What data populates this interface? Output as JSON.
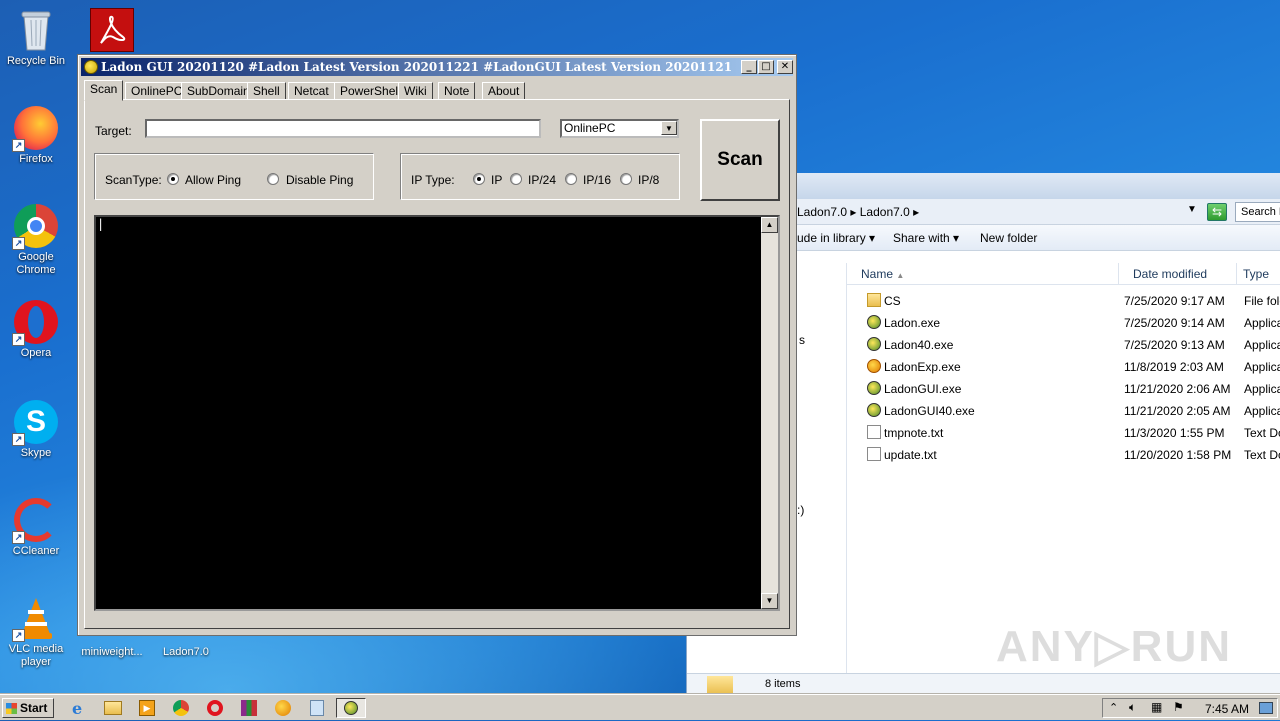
{
  "desktop": {
    "icons": [
      {
        "label": "Recycle Bin",
        "icon": "recycle-bin-icon"
      },
      {
        "label": "Firefox",
        "icon": "firefox-icon"
      },
      {
        "label": "Google Chrome",
        "icon": "chrome-icon"
      },
      {
        "label": "Opera",
        "icon": "opera-icon"
      },
      {
        "label": "Skype",
        "icon": "skype-icon"
      },
      {
        "label": "CCleaner",
        "icon": "ccleaner-icon"
      },
      {
        "label": "VLC media player",
        "icon": "vlc-icon"
      },
      {
        "label": "miniweight...",
        "icon": "file-icon"
      },
      {
        "label": "Ladon7.0",
        "icon": "folder-icon"
      }
    ]
  },
  "ladon": {
    "title": "Ladon GUI 20201120    #Ladon Latest Version 202011221    #LadonGUI Latest Version 20201121",
    "tabs": [
      "Scan",
      "OnlinePC",
      "SubDomain",
      "Shell",
      "Netcat",
      "PowerShell",
      "Wiki",
      "Note",
      "About"
    ],
    "target_label": "Target:",
    "target_value": "",
    "mode_selected": "OnlinePC",
    "scan_type_label": "ScanType:",
    "scan_type_options": [
      "Allow Ping",
      "Disable Ping"
    ],
    "scan_type_selected": "Allow Ping",
    "ip_type_label": "IP Type:",
    "ip_type_options": [
      "IP",
      "IP/24",
      "IP/16",
      "IP/8"
    ],
    "ip_type_selected": "IP",
    "scan_button": "Scan",
    "console_output": "|"
  },
  "explorer": {
    "breadcrumb": "Ladon7.0  ▸  Ladon7.0  ▸",
    "search_placeholder": "Search L",
    "toolbar": [
      "ude in library  ▾",
      "Share with  ▾",
      "New folder"
    ],
    "columns": [
      "Name",
      "Date modified",
      "Type"
    ],
    "files": [
      {
        "name": "CS",
        "date": "7/25/2020 9:17 AM",
        "type": "File fold",
        "icon": "folder-icon"
      },
      {
        "name": "Ladon.exe",
        "date": "7/25/2020 9:14 AM",
        "type": "Applicat",
        "icon": "ladon-exe-icon"
      },
      {
        "name": "Ladon40.exe",
        "date": "7/25/2020 9:13 AM",
        "type": "Applicat",
        "icon": "ladon-exe-icon"
      },
      {
        "name": "LadonExp.exe",
        "date": "11/8/2019 2:03 AM",
        "type": "Applicat",
        "icon": "ladonexp-icon"
      },
      {
        "name": "LadonGUI.exe",
        "date": "11/21/2020 2:06 AM",
        "type": "Applicat",
        "icon": "ladon-exe-icon"
      },
      {
        "name": "LadonGUI40.exe",
        "date": "11/21/2020 2:05 AM",
        "type": "Applicat",
        "icon": "ladon-exe-icon"
      },
      {
        "name": "tmpnote.txt",
        "date": "11/3/2020 1:55 PM",
        "type": "Text Do",
        "icon": "text-file-icon"
      },
      {
        "name": "update.txt",
        "date": "11/20/2020 1:58 PM",
        "type": "Text Do",
        "icon": "text-file-icon"
      }
    ],
    "nav_fragments": [
      "s",
      ":)"
    ],
    "status": "8 items"
  },
  "taskbar": {
    "start_label": "Start",
    "clock": "7:45 AM"
  },
  "watermark": "ANY▷RUN"
}
